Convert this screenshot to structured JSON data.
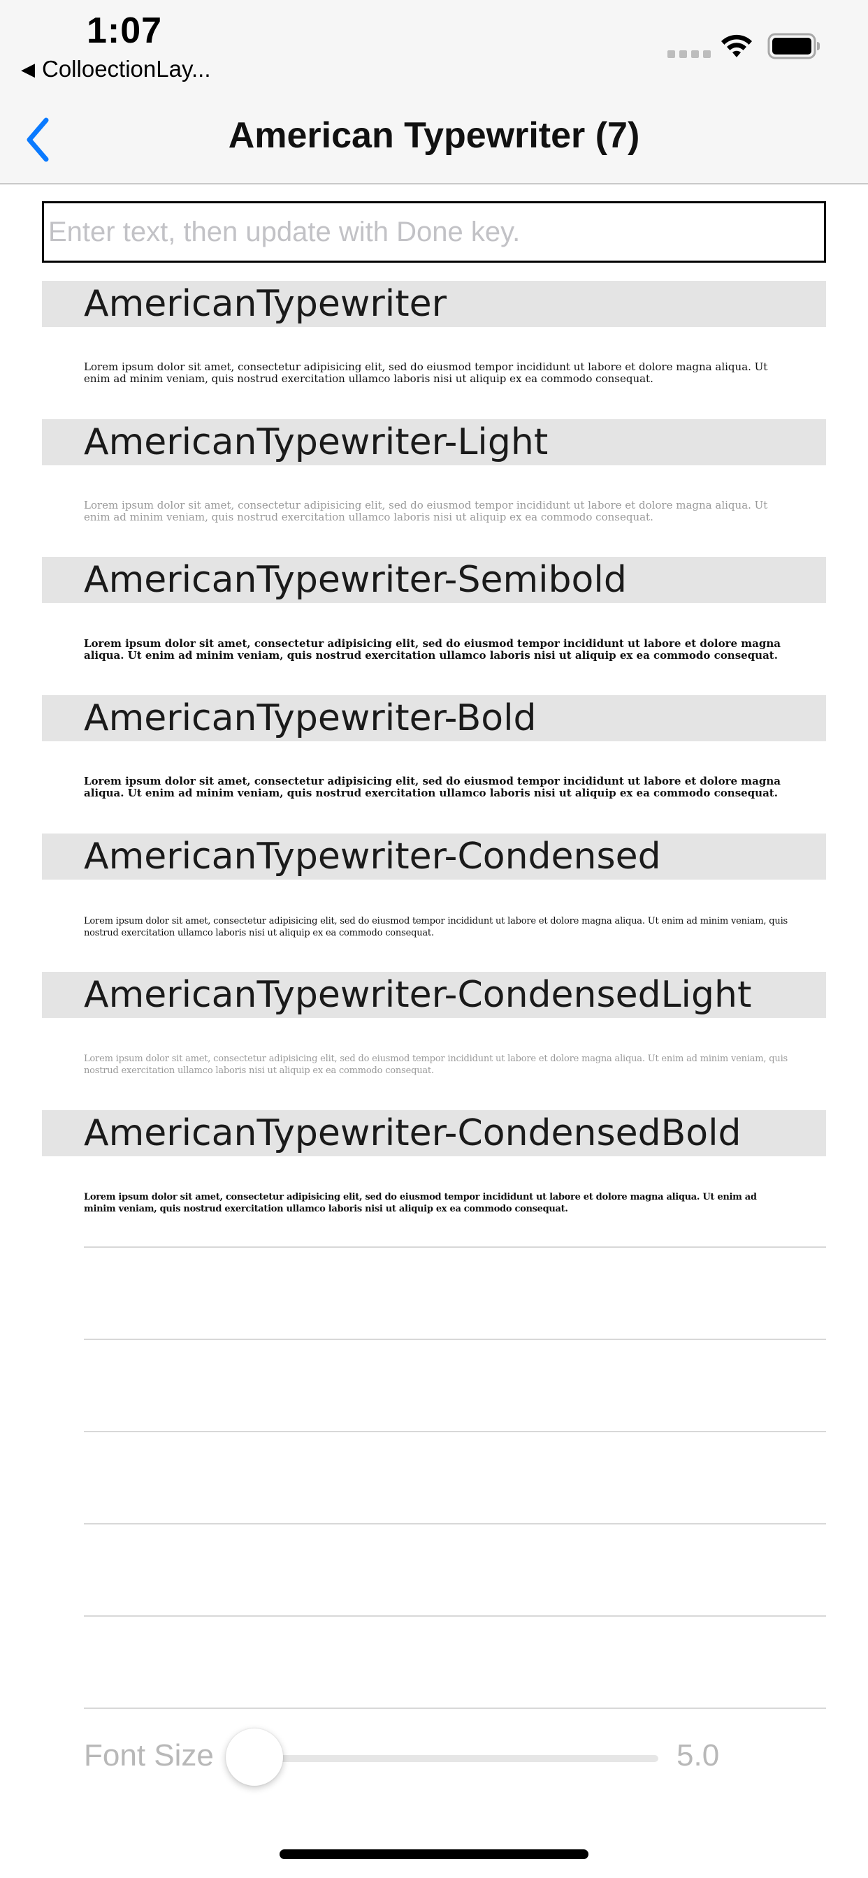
{
  "status_bar": {
    "time": "1:07",
    "back_app_label": "ColloectionLay...",
    "icons": [
      "signal-dots-icon",
      "wifi-icon",
      "battery-icon"
    ]
  },
  "nav": {
    "back_icon": "chevron-left-icon",
    "title": "American Typewriter (7)"
  },
  "text_field": {
    "placeholder": "Enter text, then update with Done key.",
    "value": ""
  },
  "fonts": [
    {
      "name": "AmericanTypewriter",
      "sample": "Lorem ipsum dolor sit amet, consectetur adipisicing elit, sed do eiusmod tempor incididunt ut labore et dolore magna aliqua. Ut enim ad minim veniam, quis nostrud exercitation ullamco laboris nisi ut aliquip ex ea commodo consequat."
    },
    {
      "name": "AmericanTypewriter-Light",
      "sample": "Lorem ipsum dolor sit amet, consectetur adipisicing elit, sed do eiusmod tempor incididunt ut labore et dolore magna aliqua. Ut enim ad minim veniam, quis nostrud exercitation ullamco laboris nisi ut aliquip ex ea commodo consequat."
    },
    {
      "name": "AmericanTypewriter-Semibold",
      "sample": "Lorem ipsum dolor sit amet, consectetur adipisicing elit, sed do eiusmod tempor incididunt ut labore et dolore magna aliqua. Ut enim ad minim veniam, quis nostrud exercitation ullamco laboris nisi ut aliquip ex ea commodo consequat."
    },
    {
      "name": "AmericanTypewriter-Bold",
      "sample": "Lorem ipsum dolor sit amet, consectetur adipisicing elit, sed do eiusmod tempor incididunt ut labore et dolore magna aliqua. Ut enim ad minim veniam, quis nostrud exercitation ullamco laboris nisi ut aliquip ex ea commodo consequat."
    },
    {
      "name": "AmericanTypewriter-Condensed",
      "sample": "Lorem ipsum dolor sit amet, consectetur adipisicing elit, sed do eiusmod tempor incididunt ut labore et dolore magna aliqua. Ut enim ad minim veniam, quis nostrud exercitation ullamco laboris nisi ut aliquip ex ea commodo consequat."
    },
    {
      "name": "AmericanTypewriter-CondensedLight",
      "sample": "Lorem ipsum dolor sit amet, consectetur adipisicing elit, sed do eiusmod tempor incididunt ut labore et dolore magna aliqua. Ut enim ad minim veniam, quis nostrud exercitation ullamco laboris nisi ut aliquip ex ea commodo consequat."
    },
    {
      "name": "AmericanTypewriter-CondensedBold",
      "sample": "Lorem ipsum dolor sit amet, consectetur adipisicing elit, sed do eiusmod tempor incididunt ut labore et dolore magna aliqua. Ut enim ad minim veniam, quis nostrud exercitation ullamco laboris nisi ut aliquip ex ea commodo consequat."
    }
  ],
  "font_size": {
    "label": "Font Size",
    "value": "5.0"
  },
  "colors": {
    "accent": "#0a7aff",
    "section_header_bg": "#e4e4e4",
    "nav_bg": "#f6f6f6",
    "slider_label": "#b8b8b8"
  }
}
